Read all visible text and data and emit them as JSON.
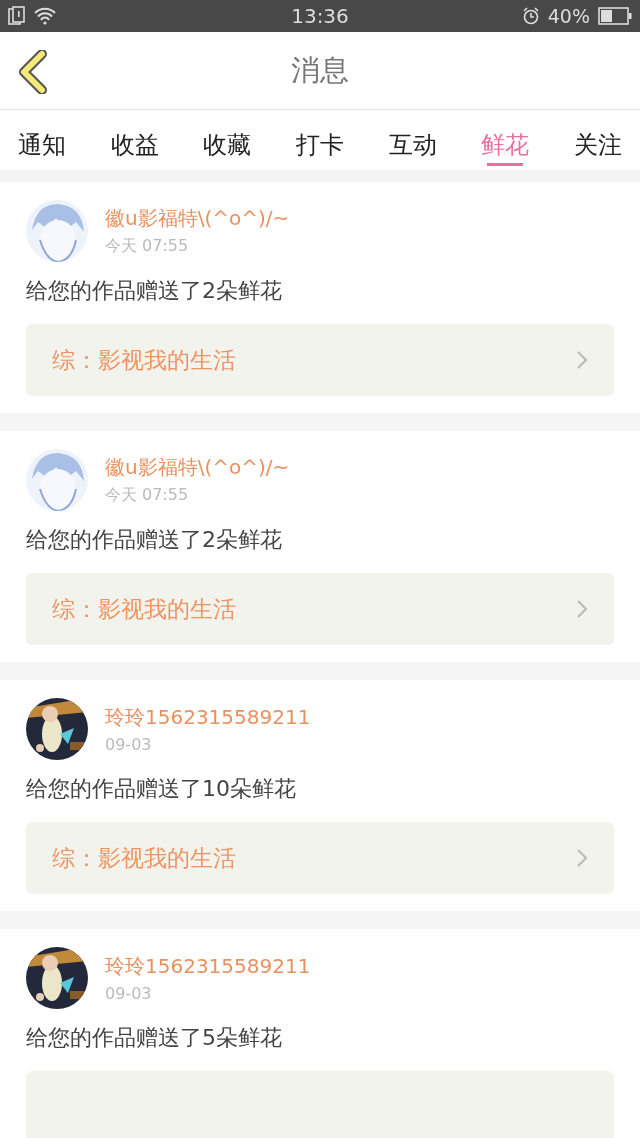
{
  "status_bar": {
    "time": "13:36",
    "battery": "40%"
  },
  "header": {
    "title": "消息"
  },
  "tabs": [
    {
      "label": "通知",
      "selected": false
    },
    {
      "label": "收益",
      "selected": false
    },
    {
      "label": "收藏",
      "selected": false
    },
    {
      "label": "打卡",
      "selected": false
    },
    {
      "label": "互动",
      "selected": false
    },
    {
      "label": "鲜花",
      "selected": true
    },
    {
      "label": "关注",
      "selected": false
    }
  ],
  "messages": [
    {
      "name": "徽u影福特\\(^o^)/~",
      "time": "今天 07:55",
      "text": "给您的作品赠送了2朵鲜花",
      "link": "综：影视我的生活"
    },
    {
      "name": "徽u影福特\\(^o^)/~",
      "time": "今天 07:55",
      "text": "给您的作品赠送了2朵鲜花",
      "link": "综：影视我的生活"
    },
    {
      "name": "玲玲1562315589211",
      "time": "09-03",
      "text": "给您的作品赠送了10朵鲜花",
      "link": "综：影视我的生活"
    },
    {
      "name": "玲玲1562315589211",
      "time": "09-03",
      "text": "给您的作品赠送了5朵鲜花"
    }
  ]
}
